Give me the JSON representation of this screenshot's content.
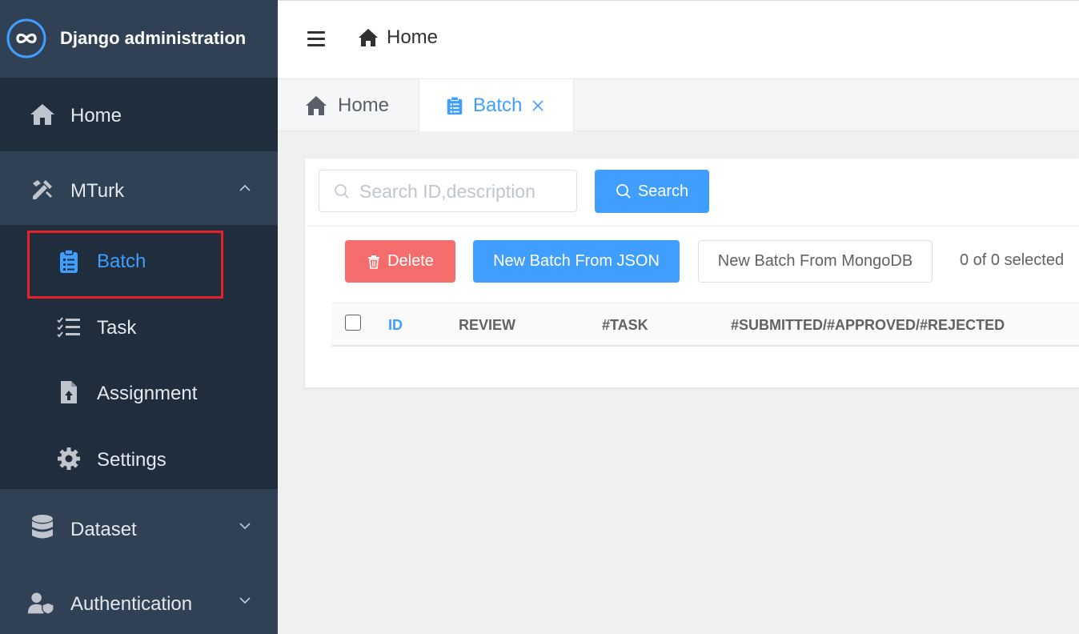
{
  "app": {
    "title": "Django administration"
  },
  "sidebar": {
    "home": {
      "label": "Home",
      "icon": "home-icon"
    },
    "mturk": {
      "label": "MTurk",
      "icon": "tools-icon",
      "expanded": true,
      "items": [
        {
          "label": "Batch",
          "icon": "clipboard-icon",
          "active": true
        },
        {
          "label": "Task",
          "icon": "checklist-icon"
        },
        {
          "label": "Assignment",
          "icon": "file-upload-icon"
        },
        {
          "label": "Settings",
          "icon": "gear-icon"
        }
      ]
    },
    "dataset": {
      "label": "Dataset",
      "icon": "database-icon"
    },
    "authentication": {
      "label": "Authentication",
      "icon": "user-shield-icon"
    }
  },
  "header": {
    "breadcrumb": "Home"
  },
  "tabs": [
    {
      "label": "Home",
      "icon": "home-icon"
    },
    {
      "label": "Batch",
      "icon": "clipboard-icon",
      "active": true
    }
  ],
  "toolbar": {
    "search_placeholder": "Search ID,description",
    "search_value": "",
    "search_label": "Search",
    "delete_label": "Delete",
    "new_json_label": "New Batch From JSON",
    "new_mongo_label": "New Batch From MongoDB",
    "selected_text": "0 of 0 selected"
  },
  "table": {
    "columns": [
      "ID",
      "REVIEW",
      "#TASK",
      "#SUBMITTED/#APPROVED/#REJECTED"
    ],
    "rows": []
  },
  "colors": {
    "sidebar_bg": "#304156",
    "sidebar_sub_bg": "#1f2d3d",
    "accent": "#409eff",
    "danger": "#f56c6c",
    "highlight": "#e8202a"
  }
}
